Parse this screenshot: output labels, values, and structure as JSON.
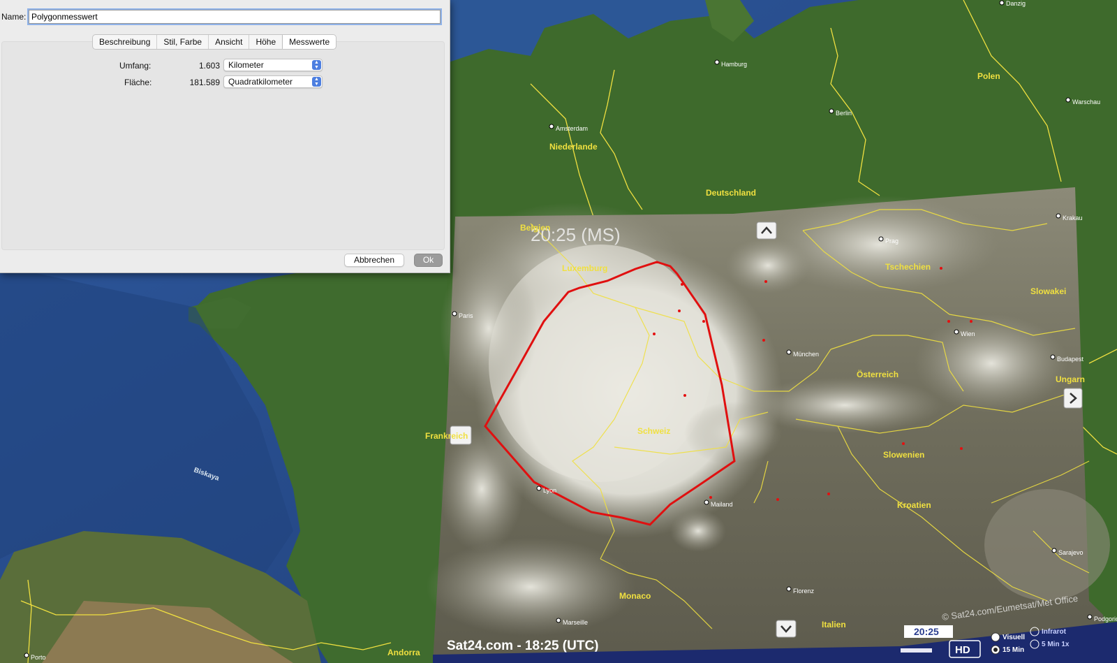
{
  "dialog": {
    "name_label": "Name:",
    "name_value": "Polygonmesswert",
    "tabs": [
      {
        "label": "Beschreibung"
      },
      {
        "label": "Stil, Farbe"
      },
      {
        "label": "Ansicht"
      },
      {
        "label": "Höhe"
      },
      {
        "label": "Messwerte",
        "active": true
      }
    ],
    "perimeter": {
      "label": "Umfang:",
      "value": "1.603",
      "unit": "Kilometer"
    },
    "area": {
      "label": "Fläche:",
      "value": "181.589",
      "unit": "Quadratkilometer"
    },
    "cancel_label": "Abbrechen",
    "ok_label": "Ok"
  },
  "map": {
    "countries": [
      "Niederlande",
      "Deutschland",
      "Polen",
      "Belgien",
      "Luxemburg",
      "Tschechien",
      "Slowakei",
      "Österreich",
      "Ungarn",
      "Frankreich",
      "Schweiz",
      "Slowenien",
      "Kroatien",
      "Monaco",
      "Italien",
      "Andorra"
    ],
    "cities": [
      "Danzig",
      "Hamburg",
      "Berlin",
      "Warschau",
      "Amsterdam",
      "Krakau",
      "Prag",
      "Paris",
      "Wien",
      "München",
      "Budapest",
      "Lyon",
      "Mailand",
      "Sarajevo",
      "Florenz",
      "Marseille",
      "Porto",
      "Podgorica"
    ],
    "sea": "Biskaya"
  },
  "overlay": {
    "time_top": "20:25 (MS)",
    "footer_time": "Sat24.com - 18:25 (UTC)",
    "copyright": "© Sat24.com/Eumetsat/Met Office",
    "slider_time": "20:25",
    "hd_label": "HD",
    "radio_visual": "Visuell",
    "radio_infrared": "Infrarot",
    "radio_15min": "15 Min",
    "radio_5min": "5 Min 1x"
  },
  "colors": {
    "polygon": "#e01010",
    "borders": "#f0e040",
    "sea": "#2b4f8a",
    "land": "#3f6a2e"
  },
  "icons": [
    "chevron-up-icon",
    "chevron-down-icon",
    "chevron-right-icon",
    "chevron-left-icon",
    "stepper-icon"
  ]
}
